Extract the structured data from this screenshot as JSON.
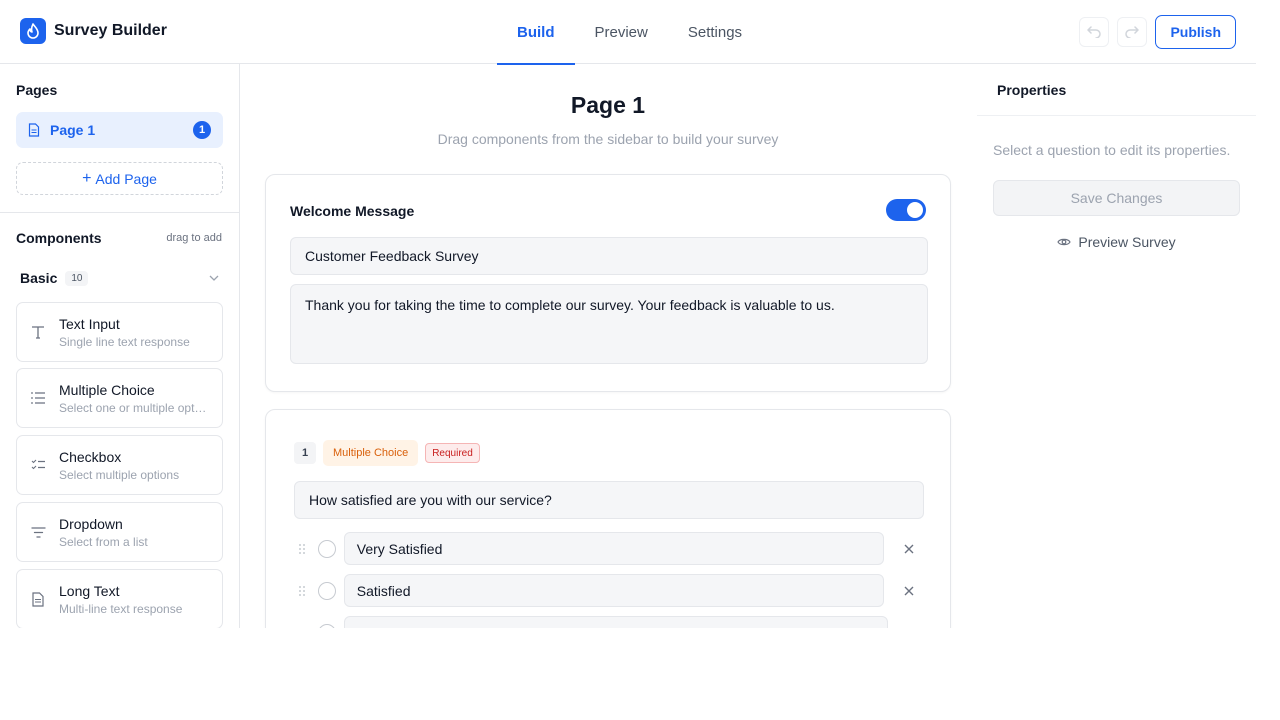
{
  "app": {
    "title": "Survey Builder"
  },
  "header": {
    "tabs": [
      {
        "label": "Build",
        "active": true
      },
      {
        "label": "Preview",
        "active": false
      },
      {
        "label": "Settings",
        "active": false
      }
    ],
    "publish_label": "Publish"
  },
  "sidebar": {
    "pages_title": "Pages",
    "pages": [
      {
        "label": "Page 1",
        "count": "1"
      }
    ],
    "add_page_label": "Add Page",
    "components_title": "Components",
    "components_hint": "drag to add",
    "group": {
      "label": "Basic",
      "count": "10"
    },
    "components": [
      {
        "name": "Text Input",
        "desc": "Single line text response",
        "icon": "text-icon"
      },
      {
        "name": "Multiple Choice",
        "desc": "Select one or multiple options",
        "icon": "list-icon"
      },
      {
        "name": "Checkbox",
        "desc": "Select multiple options",
        "icon": "checklist-icon"
      },
      {
        "name": "Dropdown",
        "desc": "Select from a list",
        "icon": "filter-icon"
      },
      {
        "name": "Long Text",
        "desc": "Multi-line text response",
        "icon": "document-icon"
      }
    ]
  },
  "main": {
    "page_title": "Page 1",
    "page_subtitle": "Drag components from the sidebar to build your survey",
    "welcome": {
      "title": "Welcome Message",
      "enabled": true,
      "heading_value": "Customer Feedback Survey",
      "body_value": "Thank you for taking the time to complete our survey. Your feedback is valuable to us."
    },
    "question": {
      "number": "1",
      "type_label": "Multiple Choice",
      "required_label": "Required",
      "text": "How satisfied are you with our service?",
      "options": [
        "Very Satisfied",
        "Satisfied",
        ""
      ]
    }
  },
  "properties": {
    "title": "Properties",
    "hint": "Select a question to edit its properties.",
    "save_label": "Save Changes",
    "preview_label": "Preview Survey"
  },
  "colors": {
    "accent": "#1d63ed",
    "required": "#c81e1e",
    "type_badge": "#d9600b"
  }
}
